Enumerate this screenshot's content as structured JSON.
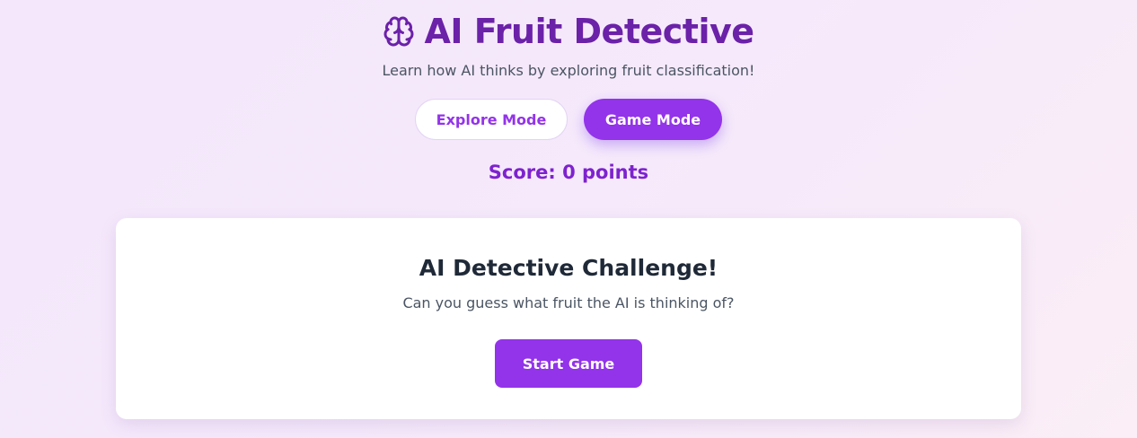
{
  "header": {
    "icon": "brain-icon",
    "title": "AI Fruit Detective",
    "subtitle": "Learn how AI thinks by exploring fruit classification!"
  },
  "modes": {
    "explore_label": "Explore Mode",
    "game_label": "Game Mode",
    "active": "Game Mode"
  },
  "score": {
    "text": "Score: 0 points"
  },
  "card": {
    "title": "AI Detective Challenge!",
    "subtitle": "Can you guess what fruit the AI is thinking of?",
    "start_label": "Start Game"
  },
  "colors": {
    "accent": "#9333ea",
    "title": "#6b21a8",
    "score": "#7e22ce",
    "background": "#f4e6fb"
  }
}
